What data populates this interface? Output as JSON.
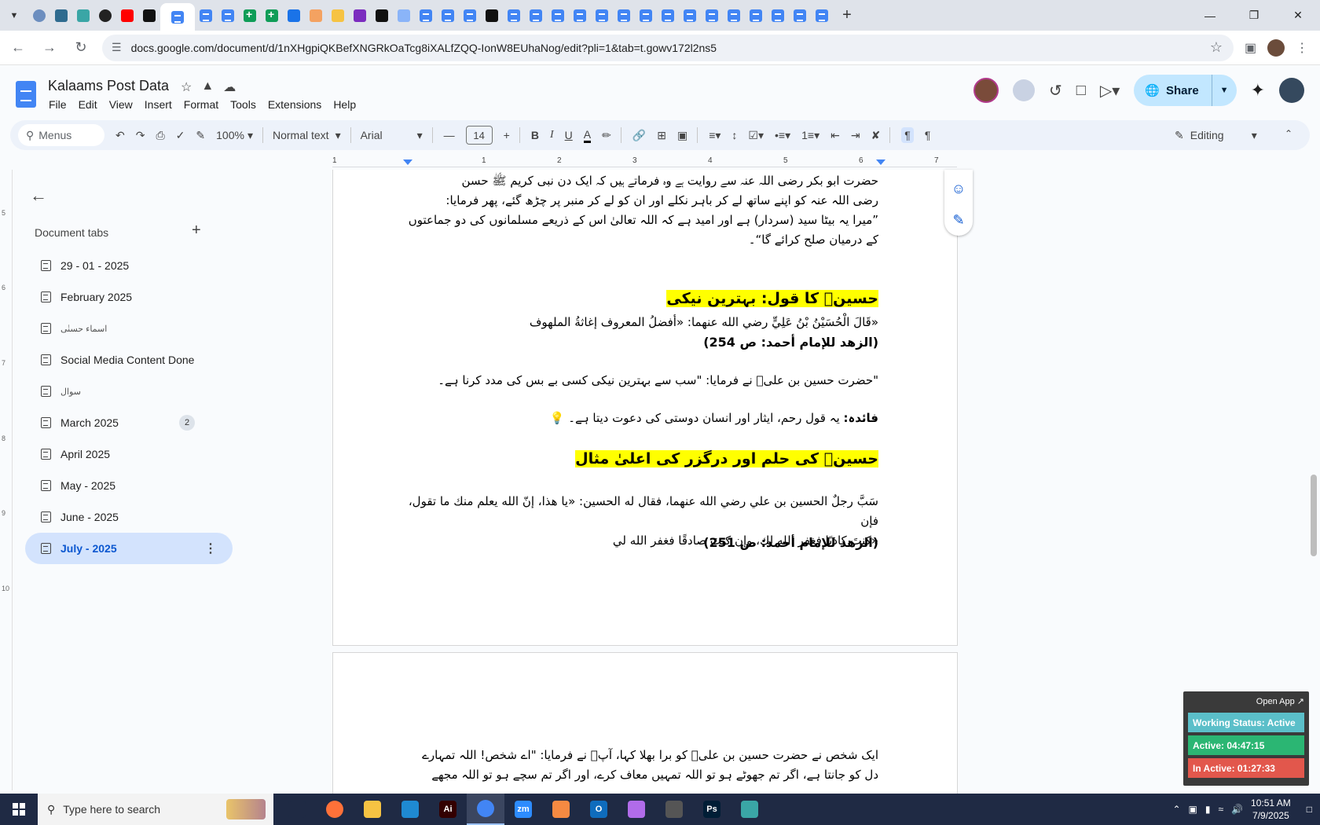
{
  "browser": {
    "new_tab_label": "+",
    "url": "docs.google.com/document/d/1nXHgpiQKBefXNGRkOaTcg8iXALfZQQ-IonW8EUhaNog/edit?pli=1&tab=t.gowv172l2ns5",
    "tabs": [
      {
        "icon": "moon-icon"
      },
      {
        "icon": "shield-icon"
      },
      {
        "icon": "hex-icon"
      },
      {
        "icon": "target-icon"
      },
      {
        "icon": "youtube-icon"
      },
      {
        "icon": "bolt-icon"
      },
      {
        "icon": "docs-icon",
        "active": true
      },
      {
        "icon": "docs-icon"
      },
      {
        "icon": "docs-icon"
      },
      {
        "icon": "sheets-icon"
      },
      {
        "icon": "sheets-icon"
      },
      {
        "icon": "blue-doc-icon"
      },
      {
        "icon": "orange-grid-icon"
      },
      {
        "icon": "crown-icon"
      },
      {
        "icon": "braces-icon"
      },
      {
        "icon": "brand-a-icon"
      },
      {
        "icon": "grid-icon"
      },
      {
        "icon": "docs-icon"
      },
      {
        "icon": "docs-icon"
      },
      {
        "icon": "docs-icon"
      },
      {
        "icon": "medium-icon"
      }
    ]
  },
  "docs": {
    "title": "Kalaams Post Data",
    "menu": [
      "File",
      "Edit",
      "View",
      "Insert",
      "Format",
      "Tools",
      "Extensions",
      "Help"
    ],
    "share_label": "Share",
    "colors": {
      "share_bg": "#c2e7ff",
      "active_tab_bg": "#d3e3fd",
      "highlight": "#ffff00"
    }
  },
  "toolbar": {
    "menus_label": "Menus",
    "zoom": "100%",
    "style": "Normal text",
    "font": "Arial",
    "font_size": "14",
    "bold": "B",
    "italic": "I",
    "underline": "U",
    "text_color_label": "A",
    "mode": "Editing"
  },
  "ruler": {
    "marks": [
      "1",
      "1",
      "2",
      "3",
      "4",
      "5",
      "6",
      "7"
    ]
  },
  "vruler": {
    "marks": [
      "5",
      "6",
      "7",
      "8",
      "9",
      "10"
    ]
  },
  "sidebar": {
    "heading": "Document tabs",
    "add_label": "+",
    "tabs": [
      {
        "label": "29 - 01 - 2025"
      },
      {
        "label": "February 2025"
      },
      {
        "label": "اسماء حسنٰی"
      },
      {
        "label": "Social Media Content Done"
      },
      {
        "label": "سوال"
      },
      {
        "label": "March 2025",
        "badge": "2"
      },
      {
        "label": "April 2025"
      },
      {
        "label": "May - 2025"
      },
      {
        "label": "June - 2025"
      },
      {
        "label": "July - 2025",
        "active": true
      }
    ]
  },
  "content": {
    "p1": [
      "حضرت ابو بکر رضی اللہ عنہ سے روایت ہے وہ فرماتے ہیں کہ ایک دن نبی کریم ﷺ حسن",
      "رضی اللہ عنہ کو اپنے ساتھ لے کر باہر نکلے اور ان کو لے کر منبر پر چڑھ گئے، پھر فرمایا:",
      "”میرا یہ بیٹا سید (سردار) ہے اور امید ہے کہ اللہ تعالیٰ اس کے ذریعے مسلمانوں کی دو جماعتوں",
      "کے درمیان صلح کرائے گا“۔"
    ],
    "h1": "حسینؓ کا قول: بہترین نیکی",
    "arabic1": "«قَالَ الْحُسَيْنُ بْنُ عَلِيٍّ رضي الله عنهما: «أفضلُ المعروف إغاثةُ الملهوف",
    "ref1": "(الزهد للإمام أحمد: ص 254)",
    "urdu1": "\"حضرت حسین بن علیؓ نے فرمایا: \"سب سے بہترین نیکی کسی بے بس کی مدد کرنا ہے۔",
    "benefit_label": "فائدہ:",
    "benefit_text": " یہ قول رحم، ایثار اور انسان دوستی کی دعوت دیتا ہے۔ 💡",
    "h2": "حسینؓ کی حلم اور درگزر کی اعلیٰ مثال",
    "arabic2a": "سَبَّ رجلٌ الحسين بن علي رضي الله عنهما، فقال له الحسين: «يا هذا، إنّ الله يعلم منك ما تقول، فإن",
    "arabic2b": "«كنتَ كاذبًا فغفر الله لك، وإن كنتَ صادقًا فغفر الله لي",
    "ref2": "(الزهد للإمام أحمد: ص 251)",
    "p2": [
      "ایک شخص نے حضرت حسین بن علیؓ کو برا بھلا کہا، آپؓ نے فرمایا: \"اے شخص! اللہ تمہارے",
      "دل کو جانتا ہے، اگر تم جھوٹے ہو تو اللہ تمہیں معاف کرے، اور اگر تم سچے ہو تو اللہ مجھے"
    ]
  },
  "tracker": {
    "open_label": "Open App ↗",
    "status": "Working Status: Active",
    "active": "Active: 04:47:15",
    "inactive": "In Active: 01:27:33"
  },
  "taskbar": {
    "search_placeholder": "Type here to search",
    "time": "10:51 AM",
    "date": "7/9/2025",
    "apps": [
      {
        "name": "task-view-icon",
        "label": "",
        "color": "#1f2a44"
      },
      {
        "name": "firefox-icon",
        "label": "",
        "color": "#ff7139"
      },
      {
        "name": "file-explorer-icon",
        "label": "",
        "color": "#f6c343"
      },
      {
        "name": "vscode-icon",
        "label": "",
        "color": "#1f8ad2"
      },
      {
        "name": "illustrator-icon",
        "label": "Ai",
        "color": "#330000"
      },
      {
        "name": "chrome-icon",
        "label": "",
        "color": "#4285f4",
        "active": true
      },
      {
        "name": "zoom-icon",
        "label": "zm",
        "color": "#2d8cff"
      },
      {
        "name": "app-icon",
        "label": "",
        "color": "#f58a42"
      },
      {
        "name": "outlook-icon",
        "label": "O",
        "color": "#0f6cbd"
      },
      {
        "name": "paint-icon",
        "label": "",
        "color": "#b16cea"
      },
      {
        "name": "pen-icon",
        "label": "",
        "color": "#555555"
      },
      {
        "name": "photoshop-icon",
        "label": "Ps",
        "color": "#001e36"
      },
      {
        "name": "browser-icon",
        "label": "",
        "color": "#3aa6a6"
      }
    ]
  }
}
